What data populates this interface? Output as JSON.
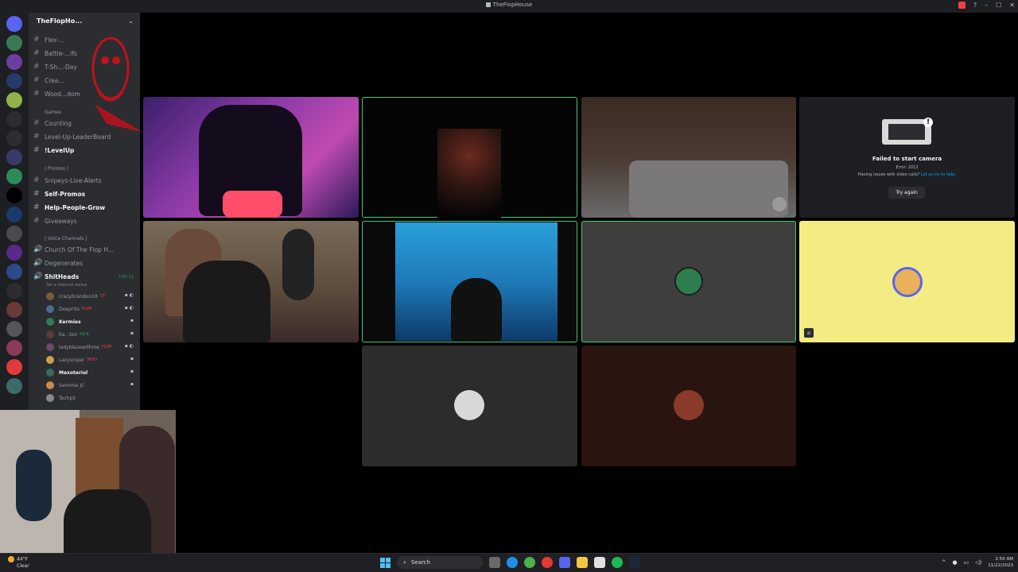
{
  "window": {
    "title": "TheFlopHouse"
  },
  "guild": {
    "name": "TheFlopHo..."
  },
  "channels": [
    {
      "label": "Flex-...",
      "type": "text",
      "bold": false
    },
    {
      "label": "Battle-...ifs",
      "type": "text",
      "bold": false
    },
    {
      "label": "T-Sh...-Day",
      "type": "text",
      "bold": false
    },
    {
      "label": "Crea...",
      "type": "text",
      "bold": false
    },
    {
      "label": "Wood...dom",
      "type": "text",
      "bold": false
    },
    {
      "label": "Counting",
      "type": "text",
      "bold": false
    },
    {
      "label": "Level-Up-LeaderBoard",
      "type": "text",
      "bold": false
    },
    {
      "label": "!LevelUp",
      "type": "text",
      "bold": true
    },
    {
      "label": "Snipeys-Live-Alerts",
      "type": "text",
      "bold": false
    },
    {
      "label": "Self-Promos",
      "type": "text",
      "bold": true
    },
    {
      "label": "Help-People-Grow",
      "type": "text",
      "bold": true
    },
    {
      "label": "Giveaways",
      "type": "text",
      "bold": false
    },
    {
      "label": "Church Of The Flop H...",
      "type": "voice",
      "bold": false
    },
    {
      "label": "Degenerates",
      "type": "voice",
      "bold": false
    },
    {
      "label": "ShitHeads",
      "type": "voice",
      "bold": true
    }
  ],
  "categories": {
    "games": "Games",
    "promos": "| Promos |",
    "voice": "| Voice Channels |"
  },
  "voice_channel": {
    "name": "ShitHeads",
    "timer": "7:07:11",
    "status_placeholder": "Set a channel status"
  },
  "voice_users": [
    {
      "name": "crazybrandon18",
      "tag": "ST",
      "bright": false,
      "color": "#7a5c3a"
    },
    {
      "name": "Deeprito",
      "tag": "FLOP",
      "bright": false,
      "color": "#4a6b8a"
    },
    {
      "name": "Kermies",
      "tag": "",
      "bright": true,
      "color": "#2e7d4f"
    },
    {
      "name": "Ka...ton",
      "tag": "RICK",
      "bright": false,
      "color": "#5a3a3a"
    },
    {
      "name": "ladyblazewithme",
      "tag": "FLOP",
      "bright": false,
      "color": "#6a4a6a"
    },
    {
      "name": "Lazysniper",
      "tag": "WHO",
      "bright": false,
      "color": "#c9a24b"
    },
    {
      "name": "Mexoteriol",
      "tag": "",
      "bright": true,
      "color": "#3a6a5a"
    },
    {
      "name": "Sammie JC",
      "tag": "",
      "bright": false,
      "color": "#c98a4b"
    },
    {
      "name": "Techpit",
      "tag": "",
      "bright": false,
      "color": "#8a8a8a"
    }
  ],
  "camera_error": {
    "title": "Failed to start camera",
    "error": "Error: 2012",
    "help_prefix": "Having issues with video calls?",
    "help_link": "Let us try to help.",
    "button": "Try again"
  },
  "taskbar": {
    "weather_temp": "44°F",
    "weather_cond": "Clear",
    "search_placeholder": "Search",
    "time": "2:50 AM",
    "date": "11/22/2023"
  },
  "colors": {
    "speaking_outline": "#43c97a",
    "sidebar": "#2b2d31",
    "rail": "#1e1f22"
  },
  "icons": [
    "hash-icon",
    "speaker-icon",
    "mic-muted-icon",
    "windows-logo-icon",
    "search-icon",
    "chrome-icon",
    "spotify-icon",
    "steam-icon"
  ]
}
